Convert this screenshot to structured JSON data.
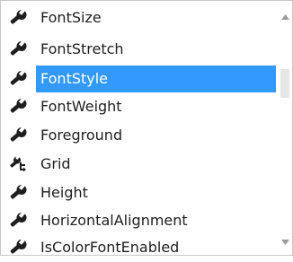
{
  "property_list": {
    "items": [
      {
        "label": "FontSize",
        "icon": "wrench-icon"
      },
      {
        "label": "FontStretch",
        "icon": "wrench-icon"
      },
      {
        "label": "FontStyle",
        "icon": "wrench-icon",
        "selected": true
      },
      {
        "label": "FontWeight",
        "icon": "wrench-icon"
      },
      {
        "label": "Foreground",
        "icon": "wrench-icon"
      },
      {
        "label": "Grid",
        "icon": "attached-property-icon"
      },
      {
        "label": "Height",
        "icon": "wrench-icon"
      },
      {
        "label": "HorizontalAlignment",
        "icon": "wrench-icon"
      },
      {
        "label": "IsColorFontEnabled",
        "icon": "wrench-icon"
      }
    ]
  },
  "colors": {
    "selection": "#3399ff",
    "text": "#1e1e1e",
    "selected_text": "#ffffff",
    "icon": "#1e1e1e",
    "scroll_thumb": "#e6e6e6"
  }
}
